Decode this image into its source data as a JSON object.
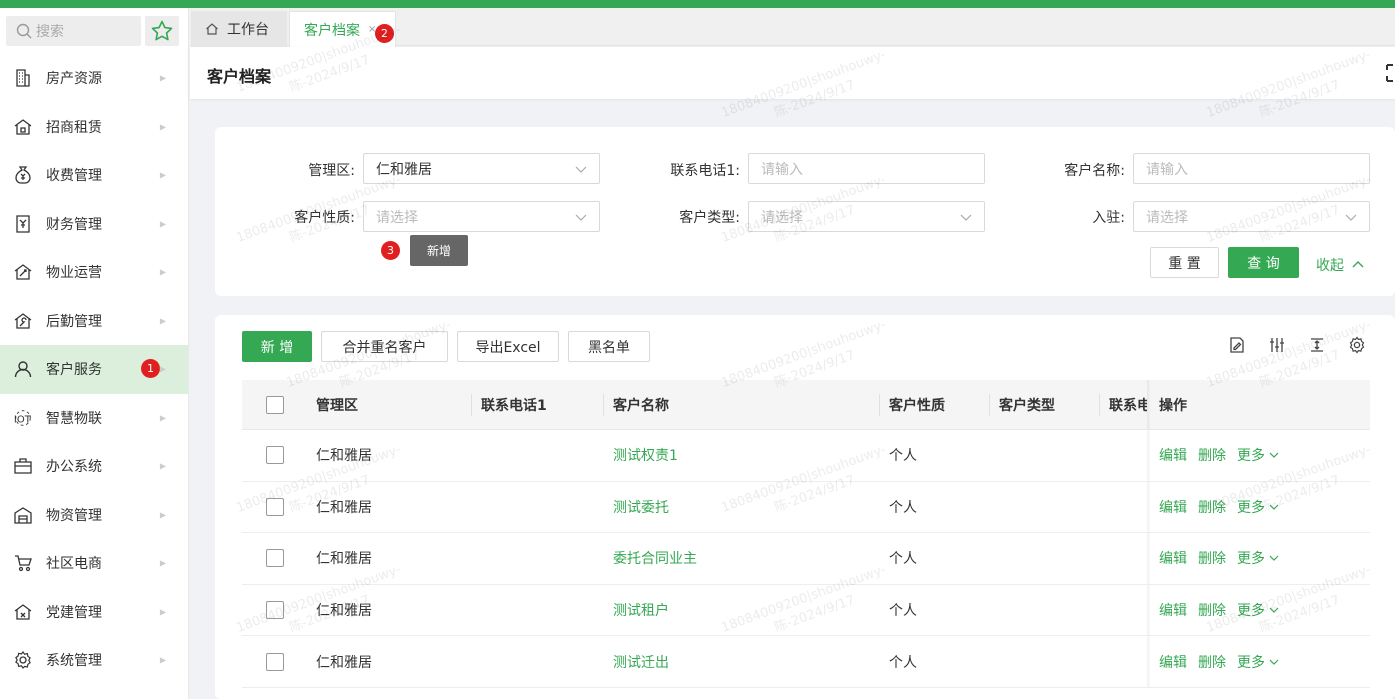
{
  "sidebar": {
    "search_placeholder": "搜索",
    "items": [
      {
        "label": "房产资源",
        "icon": "building-icon"
      },
      {
        "label": "招商租赁",
        "icon": "lease-house-icon"
      },
      {
        "label": "收费管理",
        "icon": "money-bag-icon"
      },
      {
        "label": "财务管理",
        "icon": "finance-book-icon"
      },
      {
        "label": "物业运营",
        "icon": "tools-house-icon"
      },
      {
        "label": "后勤管理",
        "icon": "wrench-house-icon"
      },
      {
        "label": "客户服务",
        "icon": "user-icon",
        "badge": "1"
      },
      {
        "label": "智慧物联",
        "icon": "iot-icon"
      },
      {
        "label": "办公系统",
        "icon": "briefcase-icon"
      },
      {
        "label": "物资管理",
        "icon": "warehouse-icon"
      },
      {
        "label": "社区电商",
        "icon": "cart-icon"
      },
      {
        "label": "党建管理",
        "icon": "party-house-icon"
      },
      {
        "label": "系统管理",
        "icon": "gear-icon"
      }
    ]
  },
  "tabs": {
    "home_label": "工作台",
    "active_label": "客户档案",
    "active_close": "×",
    "active_badge": "2"
  },
  "page": {
    "title": "客户档案"
  },
  "filters": {
    "manage_area_label": "管理区:",
    "manage_area_value": "仁和雅居",
    "phone1_label": "联系电话1:",
    "phone1_placeholder": "请输入",
    "customer_name_label": "客户名称:",
    "customer_name_placeholder": "请输入",
    "customer_nature_label": "客户性质:",
    "customer_nature_placeholder": "请选择",
    "customer_type_label": "客户类型:",
    "customer_type_placeholder": "请选择",
    "checkin_label": "入驻:",
    "checkin_placeholder": "请选择",
    "reset_label": "重 置",
    "query_label": "查 询",
    "collapse_label": "收起"
  },
  "tooltip": {
    "badge": "3",
    "text": "新增"
  },
  "toolbar": {
    "add_label": "新 增",
    "merge_label": "合并重名客户",
    "export_label": "导出Excel",
    "blacklist_label": "黑名单"
  },
  "table": {
    "headers": {
      "manage_area": "管理区",
      "phone1": "联系电话1",
      "customer_name": "客户名称",
      "customer_nature": "客户性质",
      "customer_type": "客户类型",
      "contact": "联系电",
      "actions": "操作"
    },
    "rows": [
      {
        "manage_area": "仁和雅居",
        "phone1": "",
        "customer_name": "测试权责1",
        "customer_nature": "个人",
        "customer_type": ""
      },
      {
        "manage_area": "仁和雅居",
        "phone1": "",
        "customer_name": "测试委托",
        "customer_nature": "个人",
        "customer_type": ""
      },
      {
        "manage_area": "仁和雅居",
        "phone1": "",
        "customer_name": "委托合同业主",
        "customer_nature": "个人",
        "customer_type": ""
      },
      {
        "manage_area": "仁和雅居",
        "phone1": "",
        "customer_name": "测试租户",
        "customer_nature": "个人",
        "customer_type": ""
      },
      {
        "manage_area": "仁和雅居",
        "phone1": "",
        "customer_name": "测试迁出",
        "customer_nature": "个人",
        "customer_type": ""
      }
    ],
    "action_edit": "编辑",
    "action_delete": "删除",
    "action_more": "更多"
  },
  "watermark": {
    "line1": "18084009200|shouhouwy-",
    "line2": "陈-2024/9/17"
  },
  "colors": {
    "accent": "#34a853",
    "badge": "#e02020"
  }
}
